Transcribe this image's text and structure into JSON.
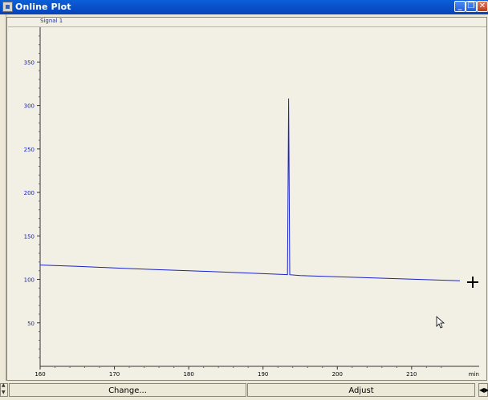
{
  "window": {
    "title": "Online Plot",
    "icon": "app-icon"
  },
  "window_buttons": [
    {
      "name": "minimize",
      "glyph": "_"
    },
    {
      "name": "restore",
      "glyph": "❐"
    },
    {
      "name": "close",
      "glyph": "✕"
    }
  ],
  "signal_tab": "Signal 1",
  "chart_data": {
    "type": "line",
    "xlabel": "min",
    "ylabel": "",
    "title": "",
    "xlim": [
      160,
      216.5
    ],
    "ylim": [
      0,
      390
    ],
    "x_ticks": [
      160,
      170,
      180,
      190,
      200,
      210
    ],
    "y_ticks": [
      50,
      100,
      150,
      200,
      250,
      300,
      350
    ],
    "series": [
      {
        "color": "#1a22c8",
        "x": [
          160,
          165,
          170,
          175,
          180,
          185,
          190,
          193.3,
          193.45,
          193.6,
          195,
          200,
          205,
          210,
          216.5
        ],
        "y": [
          116.5,
          115,
          113.2,
          111.5,
          110,
          108.3,
          106.6,
          105.5,
          308,
          105.4,
          104.5,
          103,
          101.6,
          100.2,
          98.5
        ]
      }
    ],
    "grid": false
  },
  "buttons": {
    "change": "Change...",
    "adjust": "Adjust"
  },
  "icons": {
    "spin": "spin-arrows-icon",
    "scroll": "scroll-arrows-icon"
  }
}
